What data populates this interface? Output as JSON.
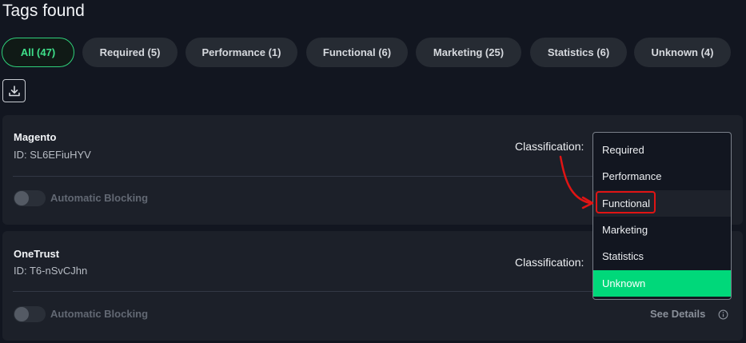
{
  "page": {
    "title": "Tags found"
  },
  "filters": [
    {
      "label": "All (47)",
      "active": true
    },
    {
      "label": "Required (5)"
    },
    {
      "label": "Performance (1)"
    },
    {
      "label": "Functional (6)"
    },
    {
      "label": "Marketing (25)"
    },
    {
      "label": "Statistics (6)"
    },
    {
      "label": "Unknown (4)"
    }
  ],
  "toolbar": {
    "download_icon": "download-icon"
  },
  "cards": [
    {
      "name": "Magento",
      "id": "ID: SL6EFiuHYV",
      "classification_label": "Classification:",
      "blocking_label": "Automatic Blocking",
      "blocking_enabled": false
    },
    {
      "name": "OneTrust",
      "id": "ID: T6-nSvCJhn",
      "classification_label": "Classification:",
      "blocking_label": "Automatic Blocking",
      "blocking_enabled": false,
      "see_details": "See Details"
    }
  ],
  "dropdown": {
    "options": [
      "Required",
      "Performance",
      "Functional",
      "Marketing",
      "Statistics",
      "Unknown"
    ],
    "selected": "Unknown",
    "highlighted": "Functional"
  },
  "colors": {
    "accent_green": "#00d87a",
    "annotation_red": "#e01414",
    "background": "#121620",
    "card": "#1c2029"
  }
}
